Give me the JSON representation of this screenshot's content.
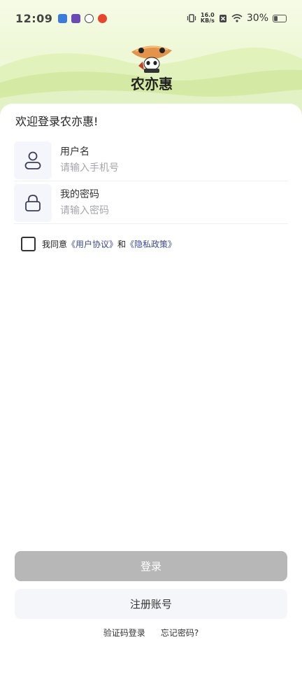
{
  "status_bar": {
    "time": "12:09",
    "net_speed_value": "16.0",
    "net_speed_unit": "KB/s",
    "battery": "30%",
    "battery_level": 0.3,
    "notification_icons": [
      "baidu-map-icon",
      "anime-app-icon",
      "link-app-icon",
      "weibo-icon"
    ],
    "status_icons": [
      "vibrate-icon",
      "sim-off-icon",
      "wifi-icon",
      "battery-icon"
    ]
  },
  "brand": {
    "name": "农亦惠",
    "colors": {
      "logo_orange": "#e4934a",
      "logo_red": "#c93a2f"
    }
  },
  "login": {
    "welcome": "欢迎登录农亦惠!",
    "username_label": "用户名",
    "username_placeholder": "请输入手机号",
    "username_value": "",
    "password_label": "我的密码",
    "password_placeholder": "请输入密码",
    "password_value": "",
    "agree_prefix": "我同意",
    "user_agreement": "《用户协议》",
    "agree_and": "和",
    "privacy_policy": "《隐私政策》",
    "agreement_checked": false,
    "login_button": "登录",
    "register_button": "注册账号",
    "sms_login_link": "验证码登录",
    "forgot_password_link": "忘记密码?"
  },
  "colors": {
    "login_button_bg": "#b7b7b7",
    "register_button_bg": "#f4f6f9",
    "link_color": "#3d4a8f",
    "hero_green": "#c9e89a"
  }
}
